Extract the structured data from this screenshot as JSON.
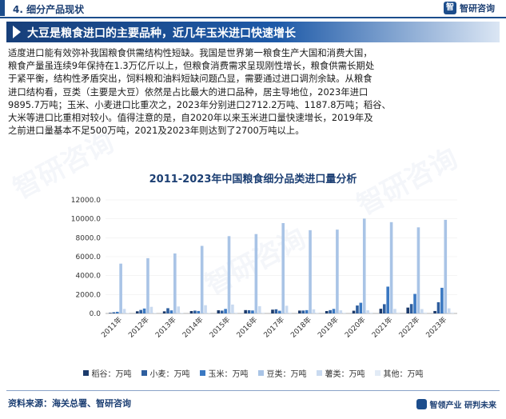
{
  "header": {
    "section": "4. 细分产品现状",
    "logo_text": "智研咨询",
    "logo_mark": "智"
  },
  "title_bar": {
    "title": "大豆是粮食进口的主要品种，近几年玉米进口快速增长"
  },
  "paragraph": {
    "lines": [
      "适度进口能有效弥补我国粮食供需结构性短缺。我国是世界第一粮食生产大国和消费大国，",
      "粮食产量虽连续9年保持在1.3万亿斤以上，但粮食消费需求呈现刚性增长，粮食供需长期处",
      "于紧平衡，结构性矛盾突出，饲料粮和油料短缺问题凸显，需要通过进口调剂余缺。从粮食",
      "进口结构看，豆类（主要是大豆）依然是占比最大的进口品种，居主导地位，2023年进口",
      "9895.7万吨；玉米、小麦进口比重次之，2023年分别进口2712.2万吨、1187.8万吨；稻谷、",
      "大米等进口比重相对较小。值得注意的是，自2020年以来玉米进口量快速增长，2019年及",
      "之前进口量基本不足500万吨，2021及2023年则达到了2700万吨以上。"
    ]
  },
  "chart_title": "2011-2023年中国粮食细分品类进口量分析",
  "chart_data": {
    "type": "bar",
    "categories": [
      "2011年",
      "2012年",
      "2013年",
      "2014年",
      "2015年",
      "2016年",
      "2017年",
      "2018年",
      "2019年",
      "2020年",
      "2021年",
      "2022年",
      "2023年"
    ],
    "ylim": [
      0,
      12000
    ],
    "yticks": [
      "0.0",
      "2000.0",
      "4000.0",
      "6000.0",
      "8000.0",
      "10000.0",
      "12000.0"
    ],
    "series": [
      {
        "name": "稻谷：万吨",
        "color": "#1b3a6b",
        "values": [
          60,
          230,
          225,
          255,
          335,
          355,
          400,
          305,
          255,
          290,
          495,
          620,
          260
        ]
      },
      {
        "name": "小麦：万吨",
        "color": "#2e5e9e",
        "values": [
          125,
          370,
          555,
          300,
          300,
          340,
          440,
          310,
          350,
          840,
          980,
          995,
          1188
        ]
      },
      {
        "name": "玉米：万吨",
        "color": "#3a78c2",
        "values": [
          175,
          520,
          325,
          260,
          475,
          315,
          285,
          350,
          480,
          1130,
          2835,
          2065,
          2712
        ]
      },
      {
        "name": "豆类：万吨",
        "color": "#a9c4e6",
        "values": [
          5265,
          5840,
          6340,
          7140,
          8170,
          8390,
          9550,
          8800,
          8860,
          10030,
          9650,
          9100,
          9896
        ]
      },
      {
        "name": "薯类：万吨",
        "color": "#c9daf0",
        "values": [
          480,
          700,
          740,
          870,
          940,
          770,
          815,
          440,
          330,
          330,
          480,
          460,
          540
        ]
      },
      {
        "name": "其他：万吨",
        "color": "#e2ebf6",
        "values": [
          80,
          80,
          80,
          90,
          110,
          110,
          110,
          100,
          100,
          110,
          120,
          120,
          120
        ]
      }
    ]
  },
  "footer": {
    "source": "资料来源：海关总署、智研咨询",
    "brand": "智领产业  研判未来"
  }
}
